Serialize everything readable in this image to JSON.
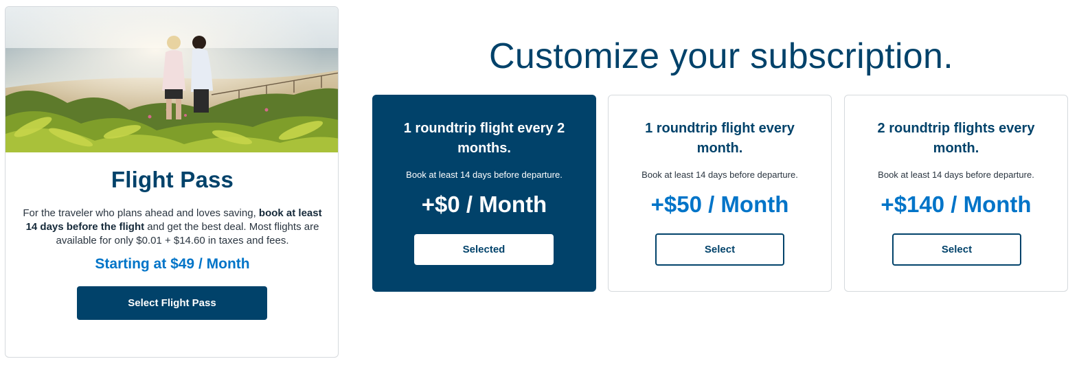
{
  "flight_pass": {
    "title": "Flight Pass",
    "description_part1": "For the traveler who plans ahead and loves saving, ",
    "description_bold": "book at least 14 days before the flight",
    "description_part2": " and get the best deal. Most flights are available for only $0.01 + $14.60 in taxes and fees.",
    "price_label": "Starting at",
    "price_value": "$49 / Month",
    "button_label": "Select Flight Pass"
  },
  "heading": "Customize your subscription.",
  "options": [
    {
      "title": "1 roundtrip flight every 2 months.",
      "note": "Book at least 14 days before departure.",
      "price": "+$0 / Month",
      "button_label": "Selected",
      "selected": true
    },
    {
      "title": "1 roundtrip flight every month.",
      "note": "Book at least 14 days before departure.",
      "price": "+$50 / Month",
      "button_label": "Select",
      "selected": false
    },
    {
      "title": "2 roundtrip flights every month.",
      "note": "Book at least 14 days before departure.",
      "price": "+$140 / Month",
      "button_label": "Select",
      "selected": false
    }
  ],
  "colors": {
    "brand_navy": "#01426a",
    "accent_blue": "#0074c8",
    "border": "#d5d9dd"
  }
}
